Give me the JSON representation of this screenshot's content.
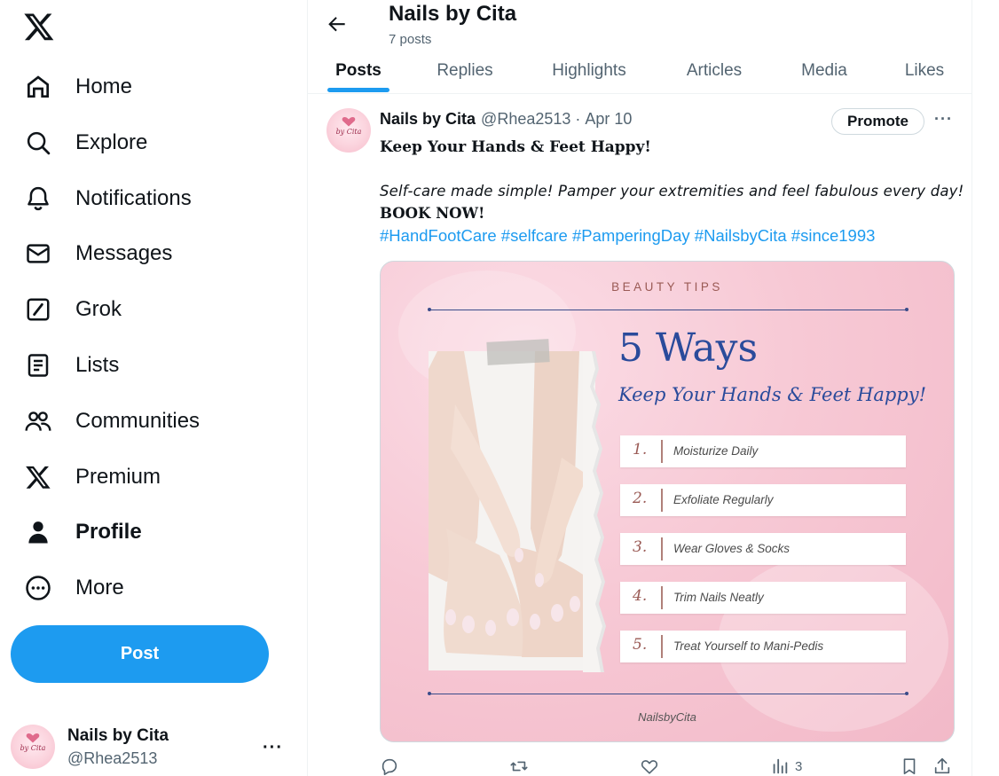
{
  "sidebar": {
    "nav": [
      {
        "label": "Home",
        "icon": "home-icon"
      },
      {
        "label": "Explore",
        "icon": "search-icon"
      },
      {
        "label": "Notifications",
        "icon": "bell-icon"
      },
      {
        "label": "Messages",
        "icon": "envelope-icon"
      },
      {
        "label": "Grok",
        "icon": "grok-icon"
      },
      {
        "label": "Lists",
        "icon": "list-icon"
      },
      {
        "label": "Communities",
        "icon": "people-icon"
      },
      {
        "label": "Premium",
        "icon": "x-logo-icon"
      },
      {
        "label": "Profile",
        "icon": "person-icon",
        "active": true
      },
      {
        "label": "More",
        "icon": "more-circle-icon"
      }
    ],
    "post_label": "Post",
    "account": {
      "name": "Nails by Cita",
      "handle": "@Rhea2513"
    },
    "account_avatar_text": "by Cita"
  },
  "header": {
    "title": "Nails by Cita",
    "post_count": "7 posts"
  },
  "tabs": [
    {
      "label": "Posts",
      "active": true
    },
    {
      "label": "Replies"
    },
    {
      "label": "Highlights"
    },
    {
      "label": "Articles"
    },
    {
      "label": "Media"
    },
    {
      "label": "Likes"
    }
  ],
  "tweet": {
    "author_name": "Nails by Cita",
    "author_handle": "@Rhea2513",
    "separator": "·",
    "date": "Apr 10",
    "promote_label": "Promote",
    "more_label": "···",
    "line1": "Keep Your Hands & Feet Happy!",
    "line2": "Self-care made simple! Pamper your extremities and feel fabulous every day!",
    "line3": "BOOK NOW!",
    "hashtags": [
      "#HandFootCare",
      "#selfcare",
      "#PamperingDay",
      "#NailsbyCita",
      "#since1993"
    ],
    "views": "3"
  },
  "media": {
    "eyebrow": "BEAUTY TIPS",
    "headline": "5 Ways",
    "subheadline": "Keep Your Hands & Feet Happy!",
    "tips": [
      {
        "num": "1.",
        "text": "Moisturize Daily"
      },
      {
        "num": "2.",
        "text": "Exfoliate Regularly"
      },
      {
        "num": "3.",
        "text": "Wear Gloves & Socks"
      },
      {
        "num": "4.",
        "text": "Trim Nails Neatly"
      },
      {
        "num": "5.",
        "text": "Treat Yourself to Mani-Pedis"
      }
    ],
    "brand": "NailsbyCita"
  },
  "colors": {
    "accent": "#1d9bf0",
    "text": "#0f1419",
    "muted": "#536471",
    "headline_blue": "#2a4b9b",
    "card_pink": "#f7c9d5"
  }
}
